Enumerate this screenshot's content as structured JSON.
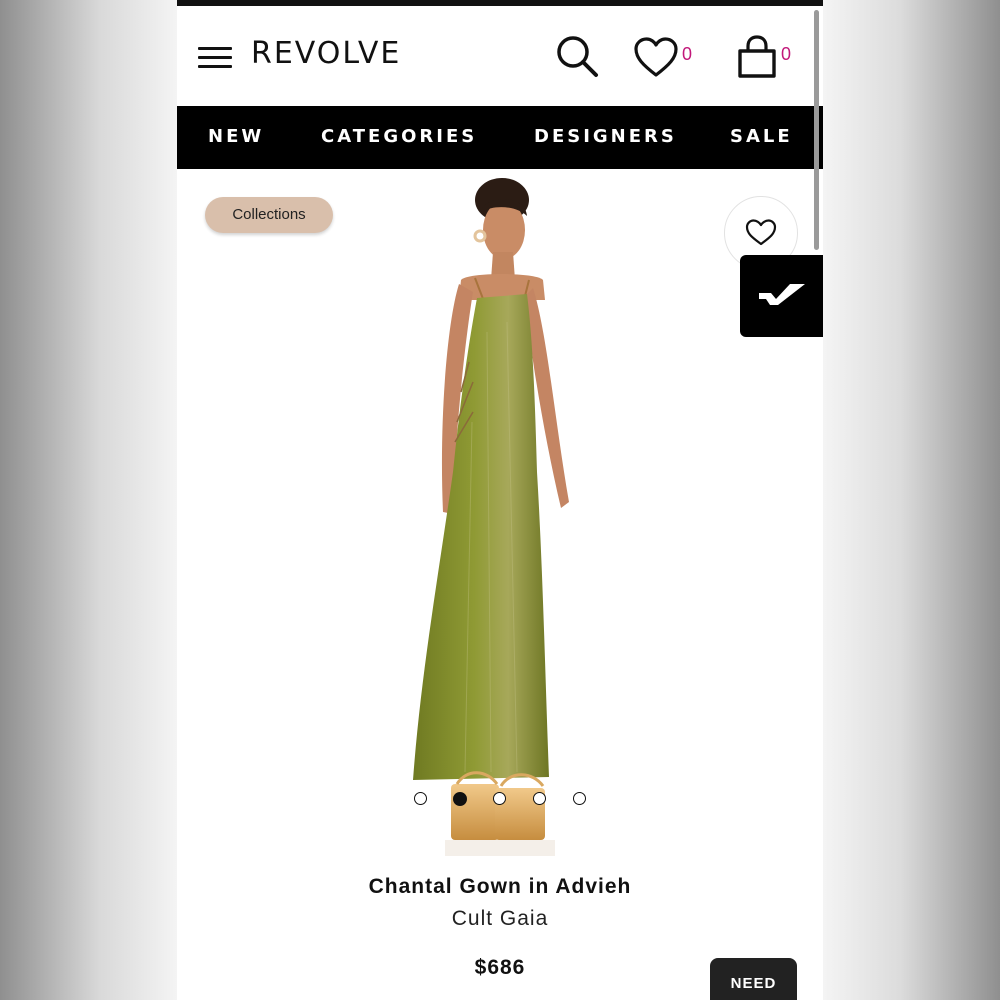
{
  "header": {
    "menu_icon": "hamburger-menu-icon",
    "logo": "REVOLVE",
    "search_icon": "search-icon",
    "wishlist_icon": "heart-icon",
    "wishlist_count": "0",
    "bag_icon": "shopping-bag-icon",
    "bag_count": "0"
  },
  "nav": {
    "items": [
      "NEW",
      "CATEGORIES",
      "DESIGNERS",
      "SALE"
    ]
  },
  "product": {
    "chip_label": "Collections",
    "favorite_icon": "heart-outline-icon",
    "floating_tab_icon": "checkmark-icon",
    "title": "Chantal Gown in Advieh",
    "brand": "Cult Gaia",
    "price": "$686",
    "image_count": 5,
    "active_image": 2,
    "dress_color": "#7e8a2a"
  },
  "help_button": {
    "label": "NEED"
  },
  "colors": {
    "accent": "#c2187a",
    "nav_bg": "#000000",
    "chip_bg": "#d9bfab"
  }
}
